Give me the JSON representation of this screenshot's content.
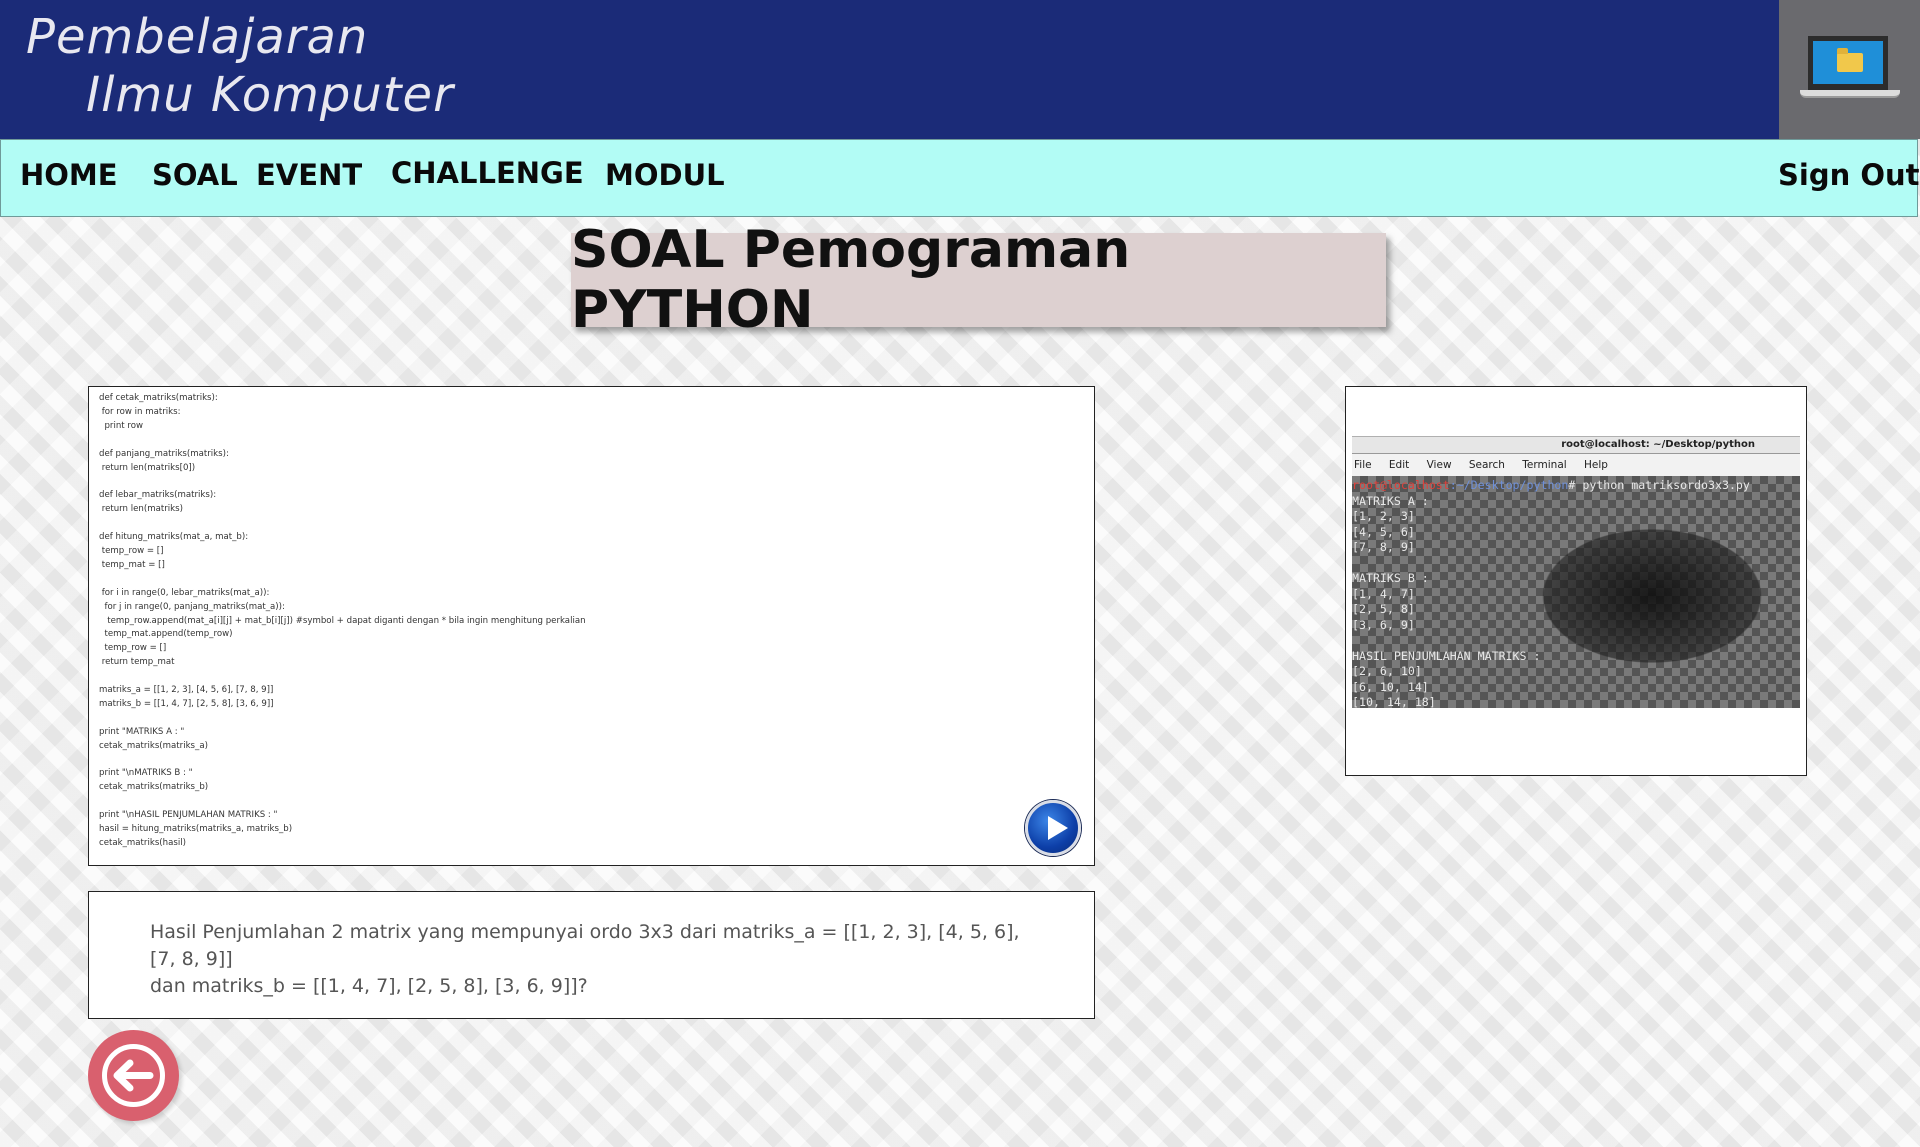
{
  "brand": {
    "line1": "Pembelajaran",
    "line2": "Ilmu Komputer",
    "logo_icon": "laptop-folder-icon"
  },
  "nav": {
    "items": [
      {
        "label": "HOME"
      },
      {
        "label": "SOAL"
      },
      {
        "label": "EVENT"
      },
      {
        "label": "CHALLENGE"
      },
      {
        "label": "MODUL"
      }
    ],
    "sign_out": "Sign Out"
  },
  "page_title": "SOAL Pemograman PYTHON",
  "code": {
    "lines": [
      "def cetak_matriks(matriks):",
      " for row in matriks:",
      "  print row",
      "",
      "def panjang_matriks(matriks):",
      " return len(matriks[0])",
      "",
      "def lebar_matriks(matriks):",
      " return len(matriks)",
      "",
      "def hitung_matriks(mat_a, mat_b):",
      " temp_row = []",
      " temp_mat = []",
      "",
      " for i in range(0, lebar_matriks(mat_a)):",
      "  for j in range(0, panjang_matriks(mat_a)):",
      "   temp_row.append(mat_a[i][j] + mat_b[i][j]) #symbol + dapat diganti dengan * bila ingin menghitung perkalian",
      "  temp_mat.append(temp_row)",
      "  temp_row = []",
      " return temp_mat",
      "",
      "matriks_a = [[1, 2, 3], [4, 5, 6], [7, 8, 9]]",
      "matriks_b = [[1, 4, 7], [2, 5, 8], [3, 6, 9]]",
      "",
      "print \"MATRIKS A : \"",
      "cetak_matriks(matriks_a)",
      "",
      "print \"\\nMATRIKS B : \"",
      "cetak_matriks(matriks_b)",
      "",
      "print \"\\nHASIL PENJUMLAHAN MATRIKS : \"",
      "hasil = hitung_matriks(matriks_a, matriks_b)",
      "cetak_matriks(hasil)"
    ],
    "play_icon": "play-icon"
  },
  "question": {
    "line1": "Hasil Penjumlahan  2 matrix yang mempunyai ordo 3x3 dari matriks_a = [[1, 2, 3], [4, 5, 6], [7, 8, 9]]",
    "line2": "dan matriks_b = [[1, 4, 7], [2, 5, 8], [3, 6, 9]]?"
  },
  "terminal": {
    "title": "root@localhost: ~/Desktop/python",
    "menu": [
      "File",
      "Edit",
      "View",
      "Search",
      "Terminal",
      "Help"
    ],
    "prompt_user": "root@localhost",
    "prompt_path": ":~/Desktop/python",
    "command": "# python matriksordo3x3.py",
    "output_lines": [
      "MATRIKS A :",
      "[1, 2, 3]",
      "[4, 5, 6]",
      "[7, 8, 9]",
      "",
      "MATRIKS B :",
      "[1, 4, 7]",
      "[2, 5, 8]",
      "[3, 6, 9]",
      "",
      "HASIL PENJUMLAHAN MATRIKS :",
      "[2, 6, 10]",
      "[6, 10, 14]",
      "[10, 14, 18]"
    ]
  },
  "back_button": {
    "icon": "arrow-left-icon"
  },
  "colors": {
    "header_bg": "#1b2b78",
    "nav_bg": "#b2fcf5",
    "title_bg": "#ddd0d0",
    "back_button": "#d9606e"
  }
}
